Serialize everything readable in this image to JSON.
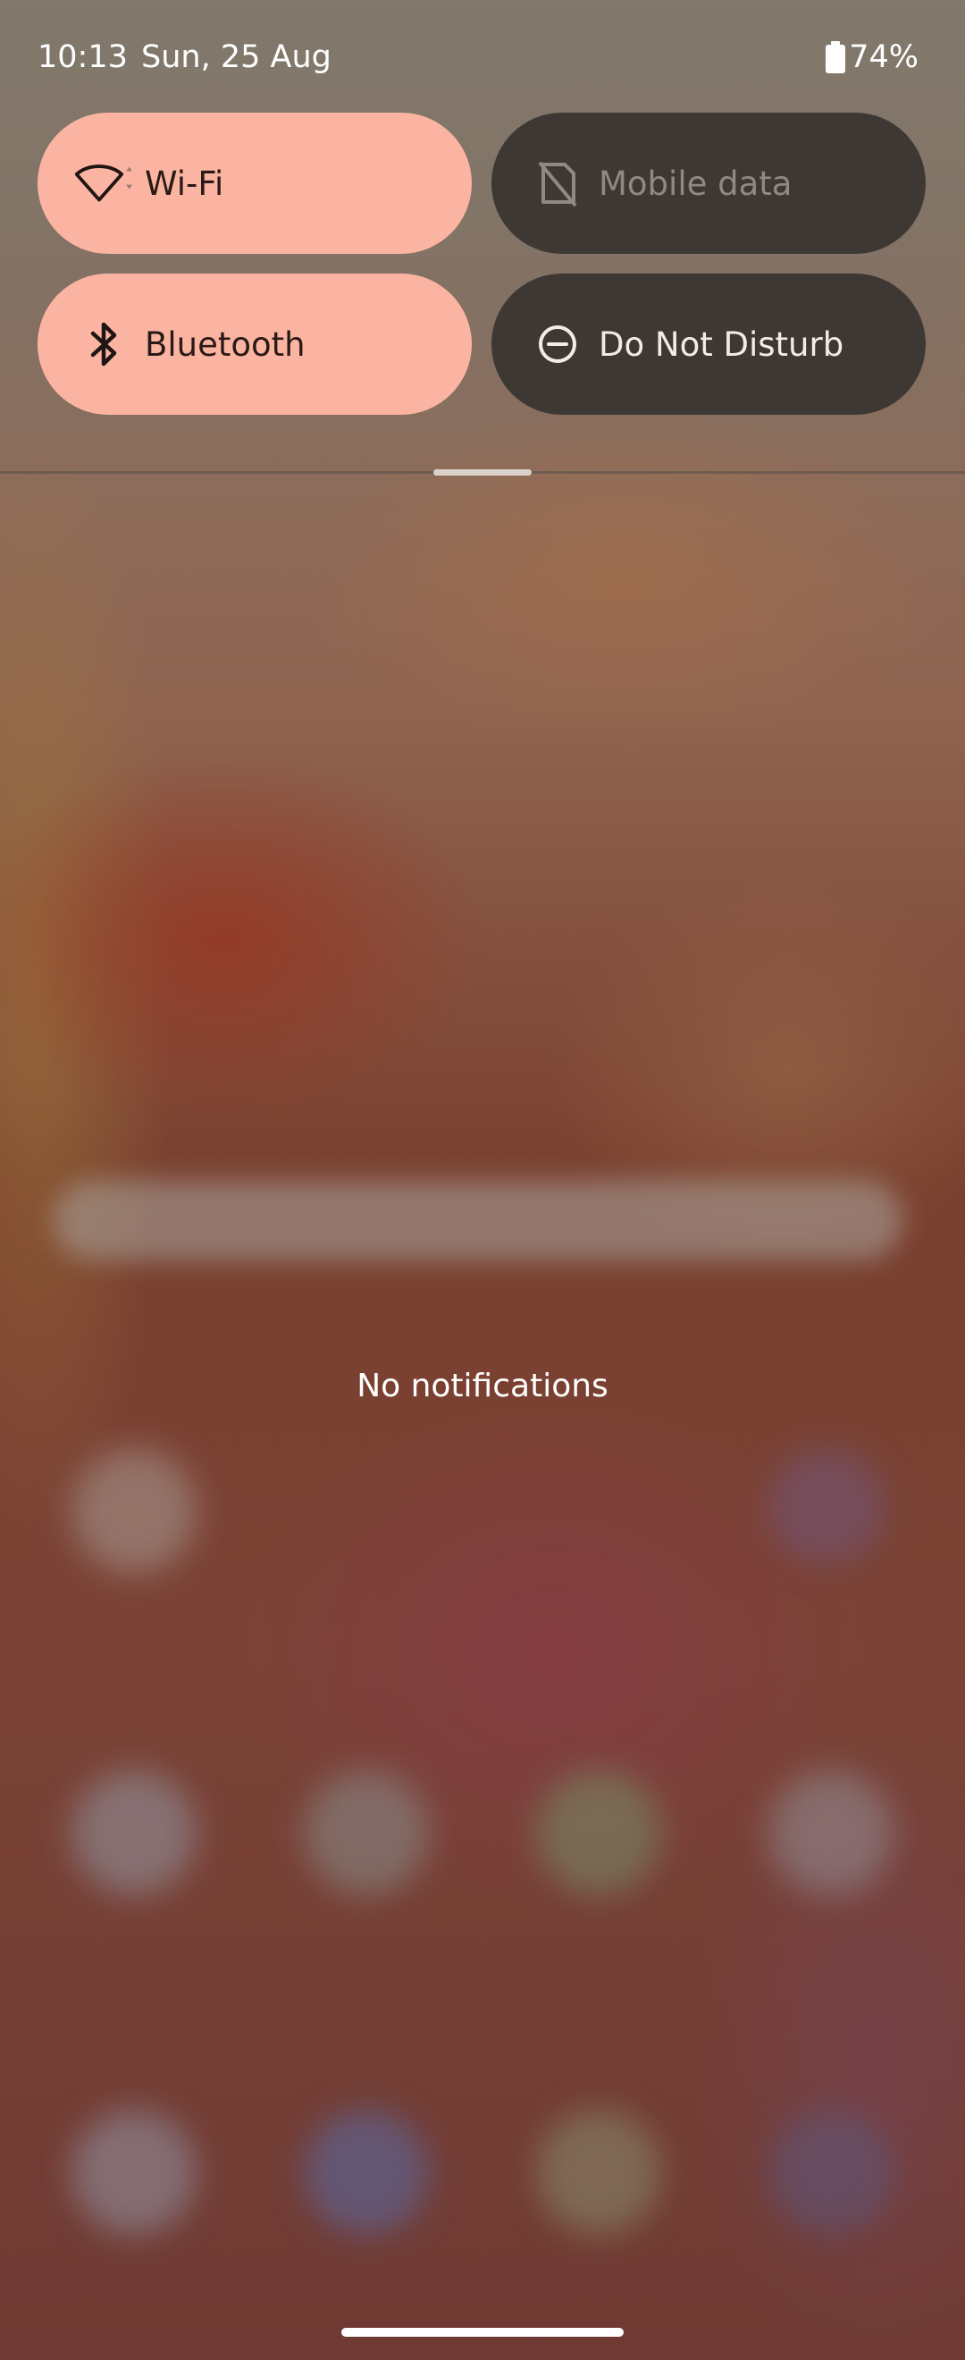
{
  "status_bar": {
    "time": "10:13",
    "date": "Sun, 25 Aug",
    "battery": "74%",
    "battery_icon": "battery-icon"
  },
  "quick_settings": {
    "tiles": [
      {
        "label": "Wi-Fi",
        "icon": "wifi-icon",
        "state": "on"
      },
      {
        "label": "Mobile data",
        "icon": "sim-off-icon",
        "state": "unavailable"
      },
      {
        "label": "Bluetooth",
        "icon": "bluetooth-icon",
        "state": "on"
      },
      {
        "label": "Do Not Disturb",
        "icon": "do-not-disturb-icon",
        "state": "off"
      }
    ]
  },
  "notifications": {
    "empty_text": "No notifications"
  },
  "colors": {
    "tile_on": "#fcb4a2",
    "tile_off": "#3e3834",
    "tile_disabled_text": "#8f8884"
  }
}
